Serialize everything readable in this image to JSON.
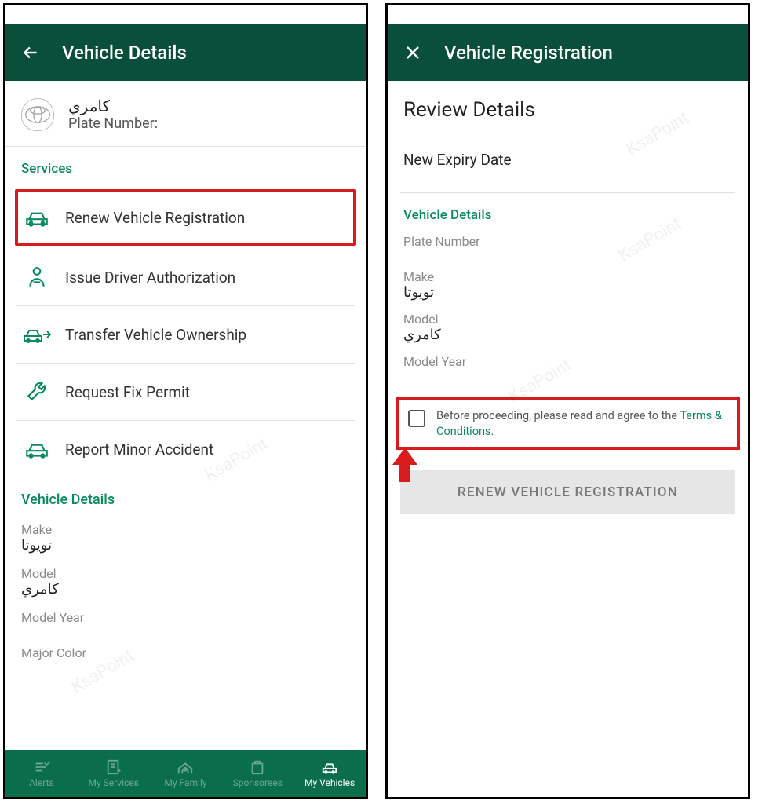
{
  "left": {
    "appbar_title": "Vehicle Details",
    "vehicle": {
      "name_ar": "كامري",
      "plate_label": "Plate Number:"
    },
    "services_header": "Services",
    "services": [
      {
        "label": "Renew Vehicle Registration",
        "highlight": true
      },
      {
        "label": "Issue Driver Authorization"
      },
      {
        "label": "Transfer Vehicle Ownership"
      },
      {
        "label": "Request Fix Permit"
      },
      {
        "label": "Report Minor Accident"
      }
    ],
    "details_header": "Vehicle Details",
    "fields": {
      "make_label": "Make",
      "make_value": "تويوتا",
      "model_label": "Model",
      "model_value": "كامري",
      "model_year_label": "Model Year",
      "major_color_label": "Major Color"
    },
    "nav": [
      {
        "label": "Alerts"
      },
      {
        "label": "My Services"
      },
      {
        "label": "My Family"
      },
      {
        "label": "Sponsorees"
      },
      {
        "label": "My Vehicles",
        "active": true
      }
    ]
  },
  "right": {
    "appbar_title": "Vehicle Registration",
    "review_title": "Review Details",
    "expiry_label": "New Expiry Date",
    "details_header": "Vehicle Details",
    "fields": {
      "plate_label": "Plate Number",
      "make_label": "Make",
      "make_value": "تويوتا",
      "model_label": "Model",
      "model_value": "كامري",
      "model_year_label": "Model Year"
    },
    "terms_prefix": "Before proceeding, please read and agree to the ",
    "terms_link": "Terms & Conditions",
    "terms_suffix": ".",
    "button_label": "RENEW VEHICLE REGISTRATION"
  },
  "watermark": "KsaPoint"
}
